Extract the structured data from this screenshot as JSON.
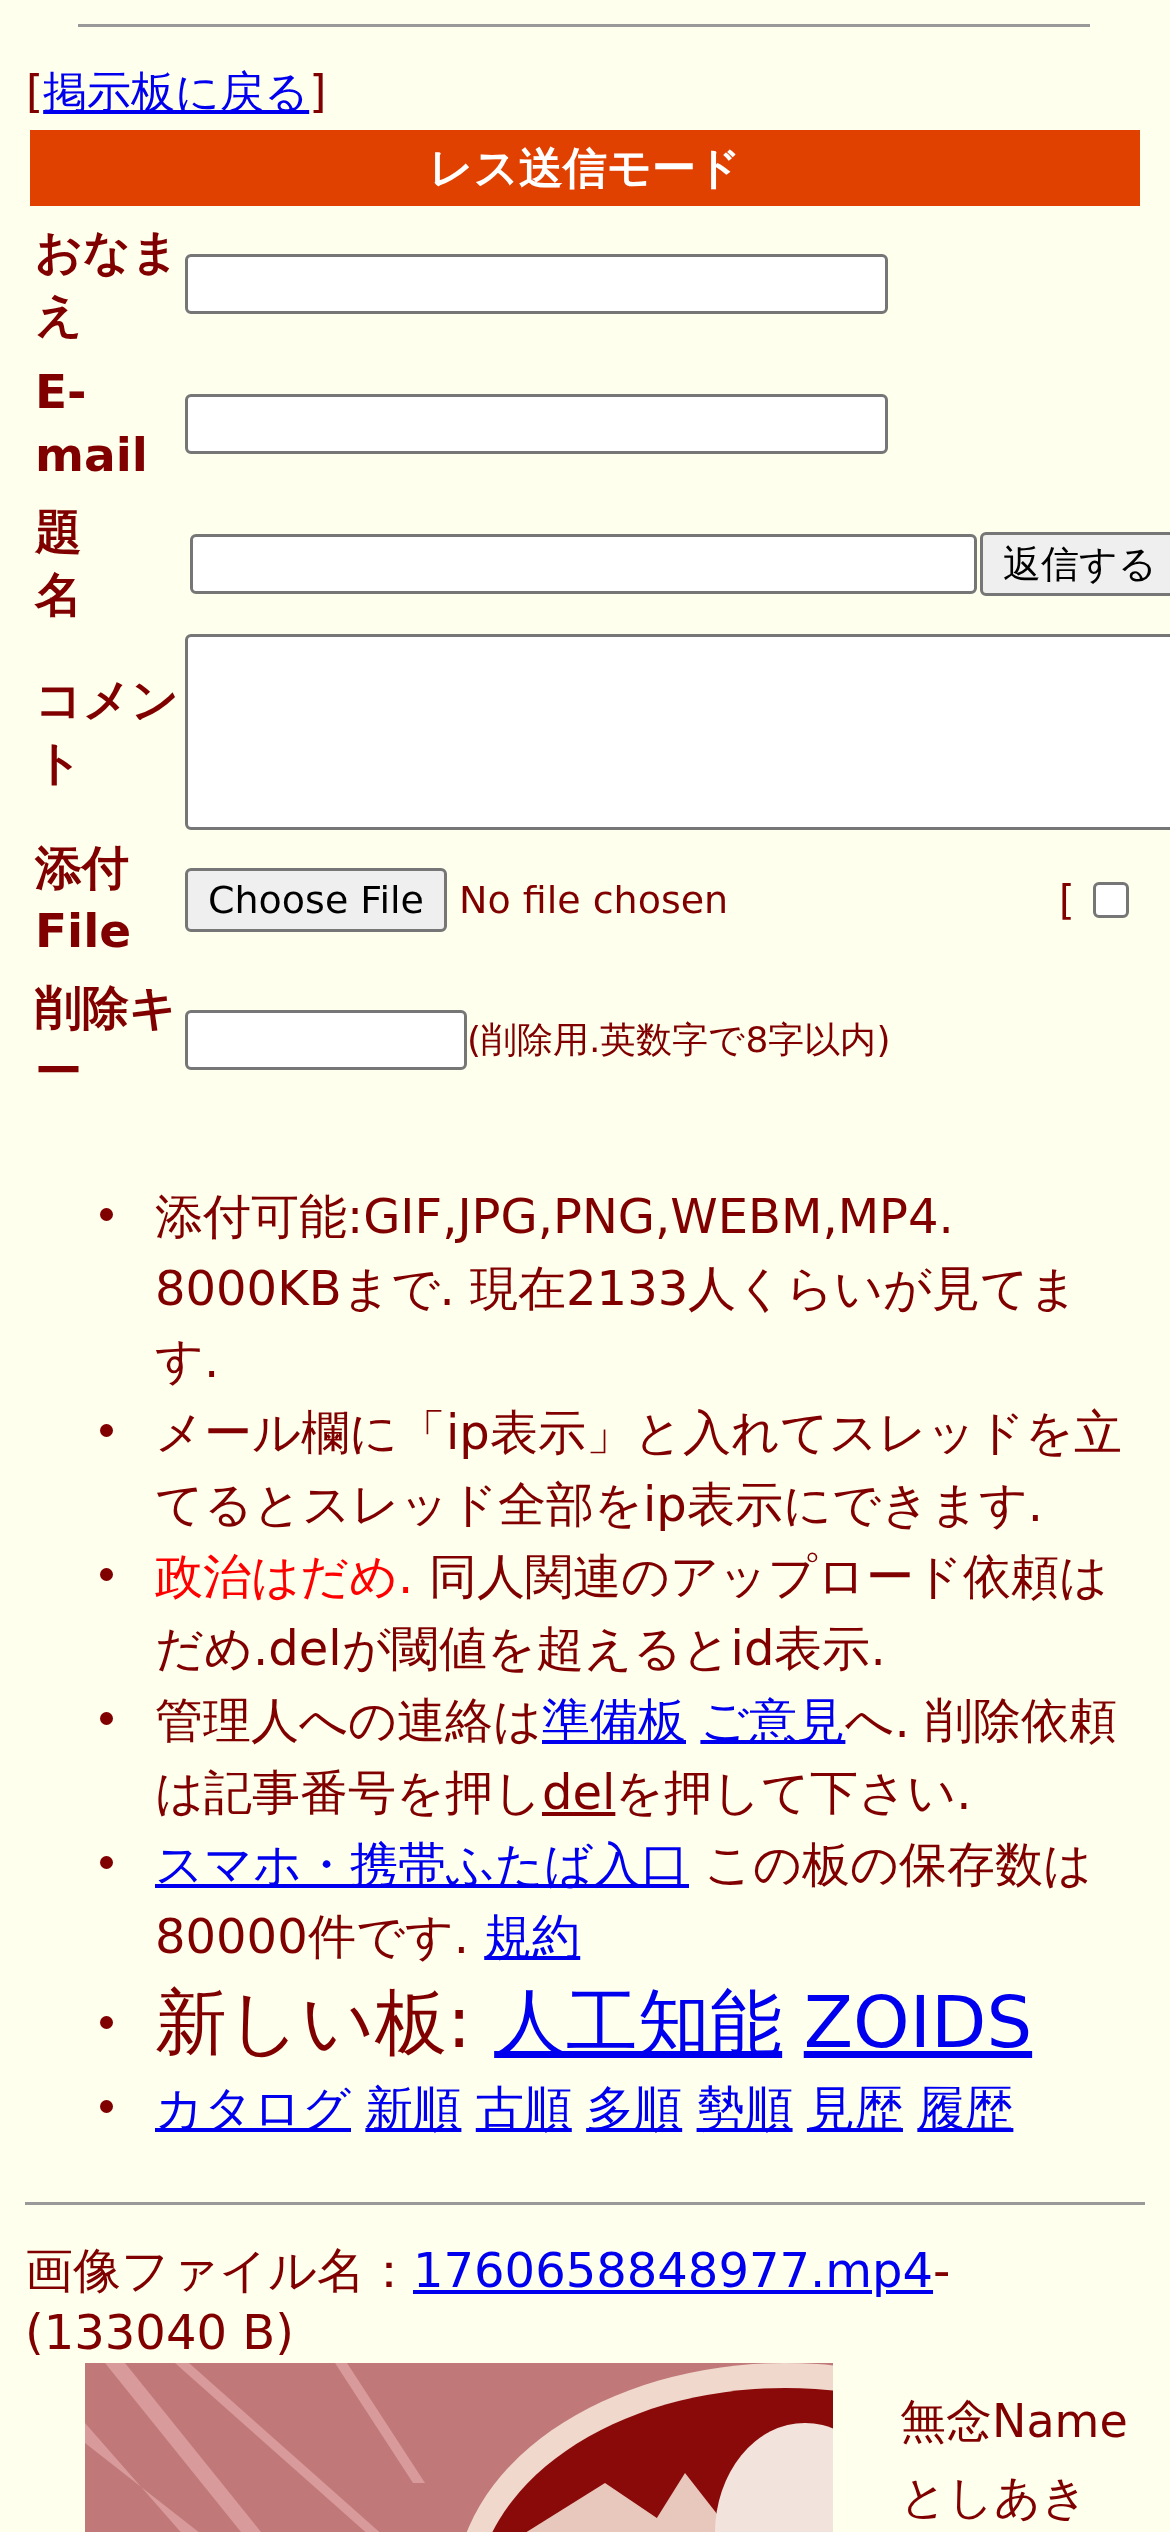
{
  "back_link": {
    "open": "[",
    "label": "掲示板に戻る",
    "close": "]"
  },
  "form": {
    "title": "レス送信モード",
    "rows": [
      {
        "kind": "text",
        "label": "おなまえ"
      },
      {
        "kind": "text",
        "label": "E-mail"
      },
      {
        "kind": "submit",
        "label": "題名",
        "button": "返信する"
      },
      {
        "kind": "textarea",
        "label": "コメント"
      },
      {
        "kind": "file",
        "label": "添付File",
        "file_button": "Choose File",
        "file_status": "No file chosen",
        "option_bracket": "[",
        "option_checked": false
      },
      {
        "kind": "key",
        "label": "削除キー",
        "hint": "(削除用.英数字で8字以内)"
      }
    ]
  },
  "notes": [
    {
      "kind": "normal",
      "segments": [
        {
          "kind": "text",
          "text": "添付可能:GIF,JPG,PNG,WEBM,MP4. 8000KBまで. 現在2133人くらいが見てます."
        }
      ]
    },
    {
      "kind": "normal",
      "segments": [
        {
          "kind": "text",
          "text": "メール欄に「ip表示」と入れてスレッドを立てるとスレッド全部をip表示にできます."
        }
      ]
    },
    {
      "kind": "normal",
      "segments": [
        {
          "kind": "alert",
          "text": "政治はだめ."
        },
        {
          "kind": "text",
          "text": " 同人関連のアップロード依頼はだめ.delが閾値を超えるとid表示."
        }
      ]
    },
    {
      "kind": "normal",
      "segments": [
        {
          "kind": "text",
          "text": "管理人への連絡は"
        },
        {
          "kind": "link",
          "text": "準備板"
        },
        {
          "kind": "link",
          "text": "ご意見"
        },
        {
          "kind": "text",
          "text": "へ. 削除依頼は記事番号を押し"
        },
        {
          "kind": "plain_link",
          "text": "del"
        },
        {
          "kind": "text",
          "text": "を押して下さい."
        }
      ]
    },
    {
      "kind": "normal",
      "segments": [
        {
          "kind": "link",
          "text": "スマホ・携帯ふたば入口"
        },
        {
          "kind": "text",
          "text": " この板の保存数は80000件です. "
        },
        {
          "kind": "link",
          "text": "規約"
        }
      ]
    },
    {
      "kind": "large",
      "segments": [
        {
          "kind": "text",
          "text": "新しい板: "
        },
        {
          "kind": "link",
          "text": "人工知能"
        },
        {
          "kind": "link",
          "text": "ZOIDS"
        }
      ]
    },
    {
      "kind": "normal",
      "segments": [
        {
          "kind": "link",
          "text": "カタログ"
        },
        {
          "kind": "link",
          "text": "新順"
        },
        {
          "kind": "link",
          "text": "古順"
        },
        {
          "kind": "link",
          "text": "多順"
        },
        {
          "kind": "link",
          "text": "勢順"
        },
        {
          "kind": "link",
          "text": "見歴"
        },
        {
          "kind": "link",
          "text": "履歴"
        }
      ]
    }
  ],
  "post": {
    "file_label": "画像ファイル名：",
    "file_name": "1760658848977.mp4",
    "file_size": "-(133040 B)",
    "header": "無念Name",
    "name": "としあき"
  }
}
